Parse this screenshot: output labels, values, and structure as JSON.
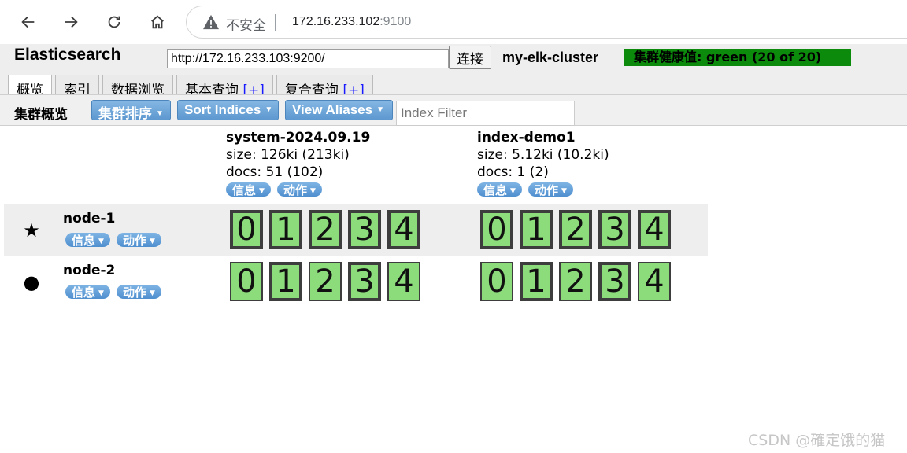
{
  "browser": {
    "insecure_label": "不安全",
    "url_host": "172.16.233.102",
    "url_port": ":9100",
    "icons": [
      "back-arrow-icon",
      "forward-arrow-icon",
      "reload-icon",
      "home-icon",
      "warning-icon"
    ]
  },
  "header": {
    "title": "Elasticsearch",
    "connect_url": "http://172.16.233.103:9200/",
    "connect_label": "连接",
    "cluster_name": "my-elk-cluster",
    "health_text": "集群健康值: green (20 of 20)",
    "health_color": "#0c8a0c"
  },
  "tabs": [
    {
      "label": "概览",
      "plus": ""
    },
    {
      "label": "索引",
      "plus": ""
    },
    {
      "label": "数据浏览",
      "plus": ""
    },
    {
      "label": "基本查询 ",
      "plus": "[+]"
    },
    {
      "label": "复合查询 ",
      "plus": "[+]"
    }
  ],
  "toolbar": {
    "title": "集群概览",
    "sort_cluster_label": "集群排序",
    "sort_indices_label": "Sort Indices",
    "view_aliases_label": "View Aliases",
    "filter_placeholder": "Index Filter"
  },
  "pills": {
    "info_label": "信息",
    "action_label": "动作"
  },
  "indices": [
    {
      "name": "system-2024.09.19",
      "size": "size: 126ki (213ki)",
      "docs": "docs: 51 (102)"
    },
    {
      "name": "index-demo1",
      "size": "size: 5.12ki (10.2ki)",
      "docs": "docs: 1 (2)"
    }
  ],
  "nodes": [
    {
      "name": "node-1",
      "marker": "★",
      "marker_icon": "star-icon",
      "shards": [
        [
          "0",
          "1",
          "2",
          "3",
          "4"
        ],
        [
          "0",
          "1",
          "2",
          "3",
          "4"
        ]
      ]
    },
    {
      "name": "node-2",
      "marker": "●",
      "marker_icon": "dot-icon",
      "shards": [
        [
          "0",
          "1",
          "2",
          "3",
          "4"
        ],
        [
          "0",
          "1",
          "2",
          "3",
          "4"
        ]
      ]
    }
  ],
  "colors": {
    "shard_fill": "#8ddc7c",
    "pill_blue": "#5d98d0"
  },
  "watermark": "CSDN @確定饿的猫"
}
